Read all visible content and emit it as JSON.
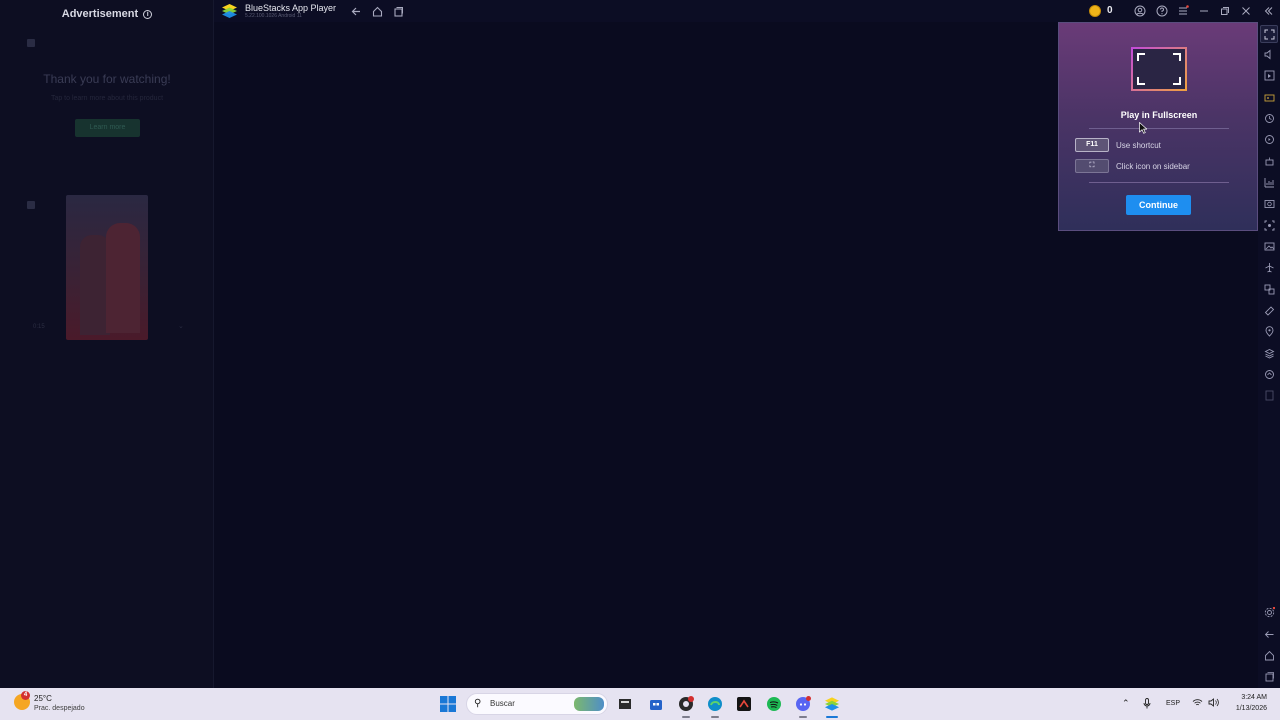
{
  "ad": {
    "title": "Advertisement",
    "info_icon": "i",
    "thanks": "Thank you for watching!",
    "subtitle": "Tap to learn more about this product",
    "learn_more": "Learn more",
    "video_time": "0:15",
    "chevron": "⌄"
  },
  "titlebar": {
    "app_name": "BlueStacks App Player",
    "version": "5.22.100.1026 Android 11",
    "coins": "0"
  },
  "popup": {
    "title": "Play in Fullscreen",
    "options": [
      {
        "key": "F11",
        "label": "Use shortcut"
      },
      {
        "key": "⛶",
        "label": "Click icon on sidebar"
      }
    ],
    "continue_label": "Continue"
  },
  "taskbar": {
    "weather_badge": "4",
    "temperature": "25°C",
    "weather_desc": "Prac. despejado",
    "search_placeholder": "Buscar",
    "language": "ESP",
    "time": "3:24 AM",
    "date": "1/13/2026"
  },
  "colors": {
    "accent": "#1e8ef0",
    "background": "#0a0b1f",
    "popup_top": "#6a3b78"
  }
}
